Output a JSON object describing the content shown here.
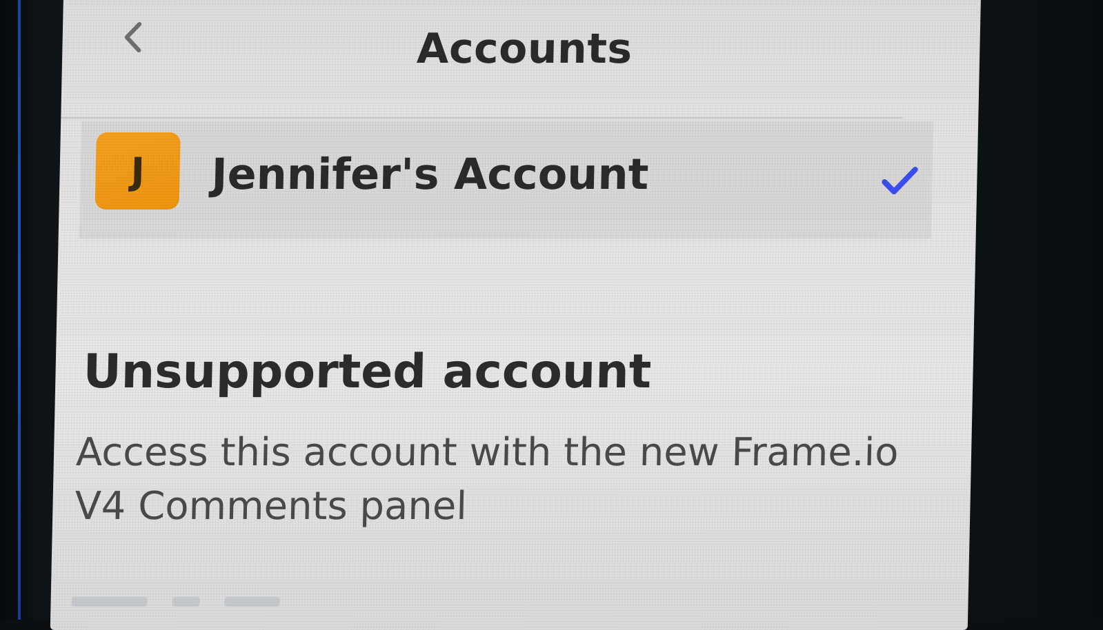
{
  "header": {
    "back_icon": "chevron-left-icon",
    "title": "Accounts"
  },
  "accounts": [
    {
      "avatar_letter": "J",
      "avatar_color": "#f29b16",
      "name": "Jennifer's Account",
      "selected": true,
      "check_icon": "checkmark-icon",
      "check_color": "#3b4ef0"
    }
  ],
  "notice": {
    "title": "Unsupported account",
    "description_line1": "Access this account with the new Frame.io",
    "description_line2": "V4 Comments panel"
  }
}
